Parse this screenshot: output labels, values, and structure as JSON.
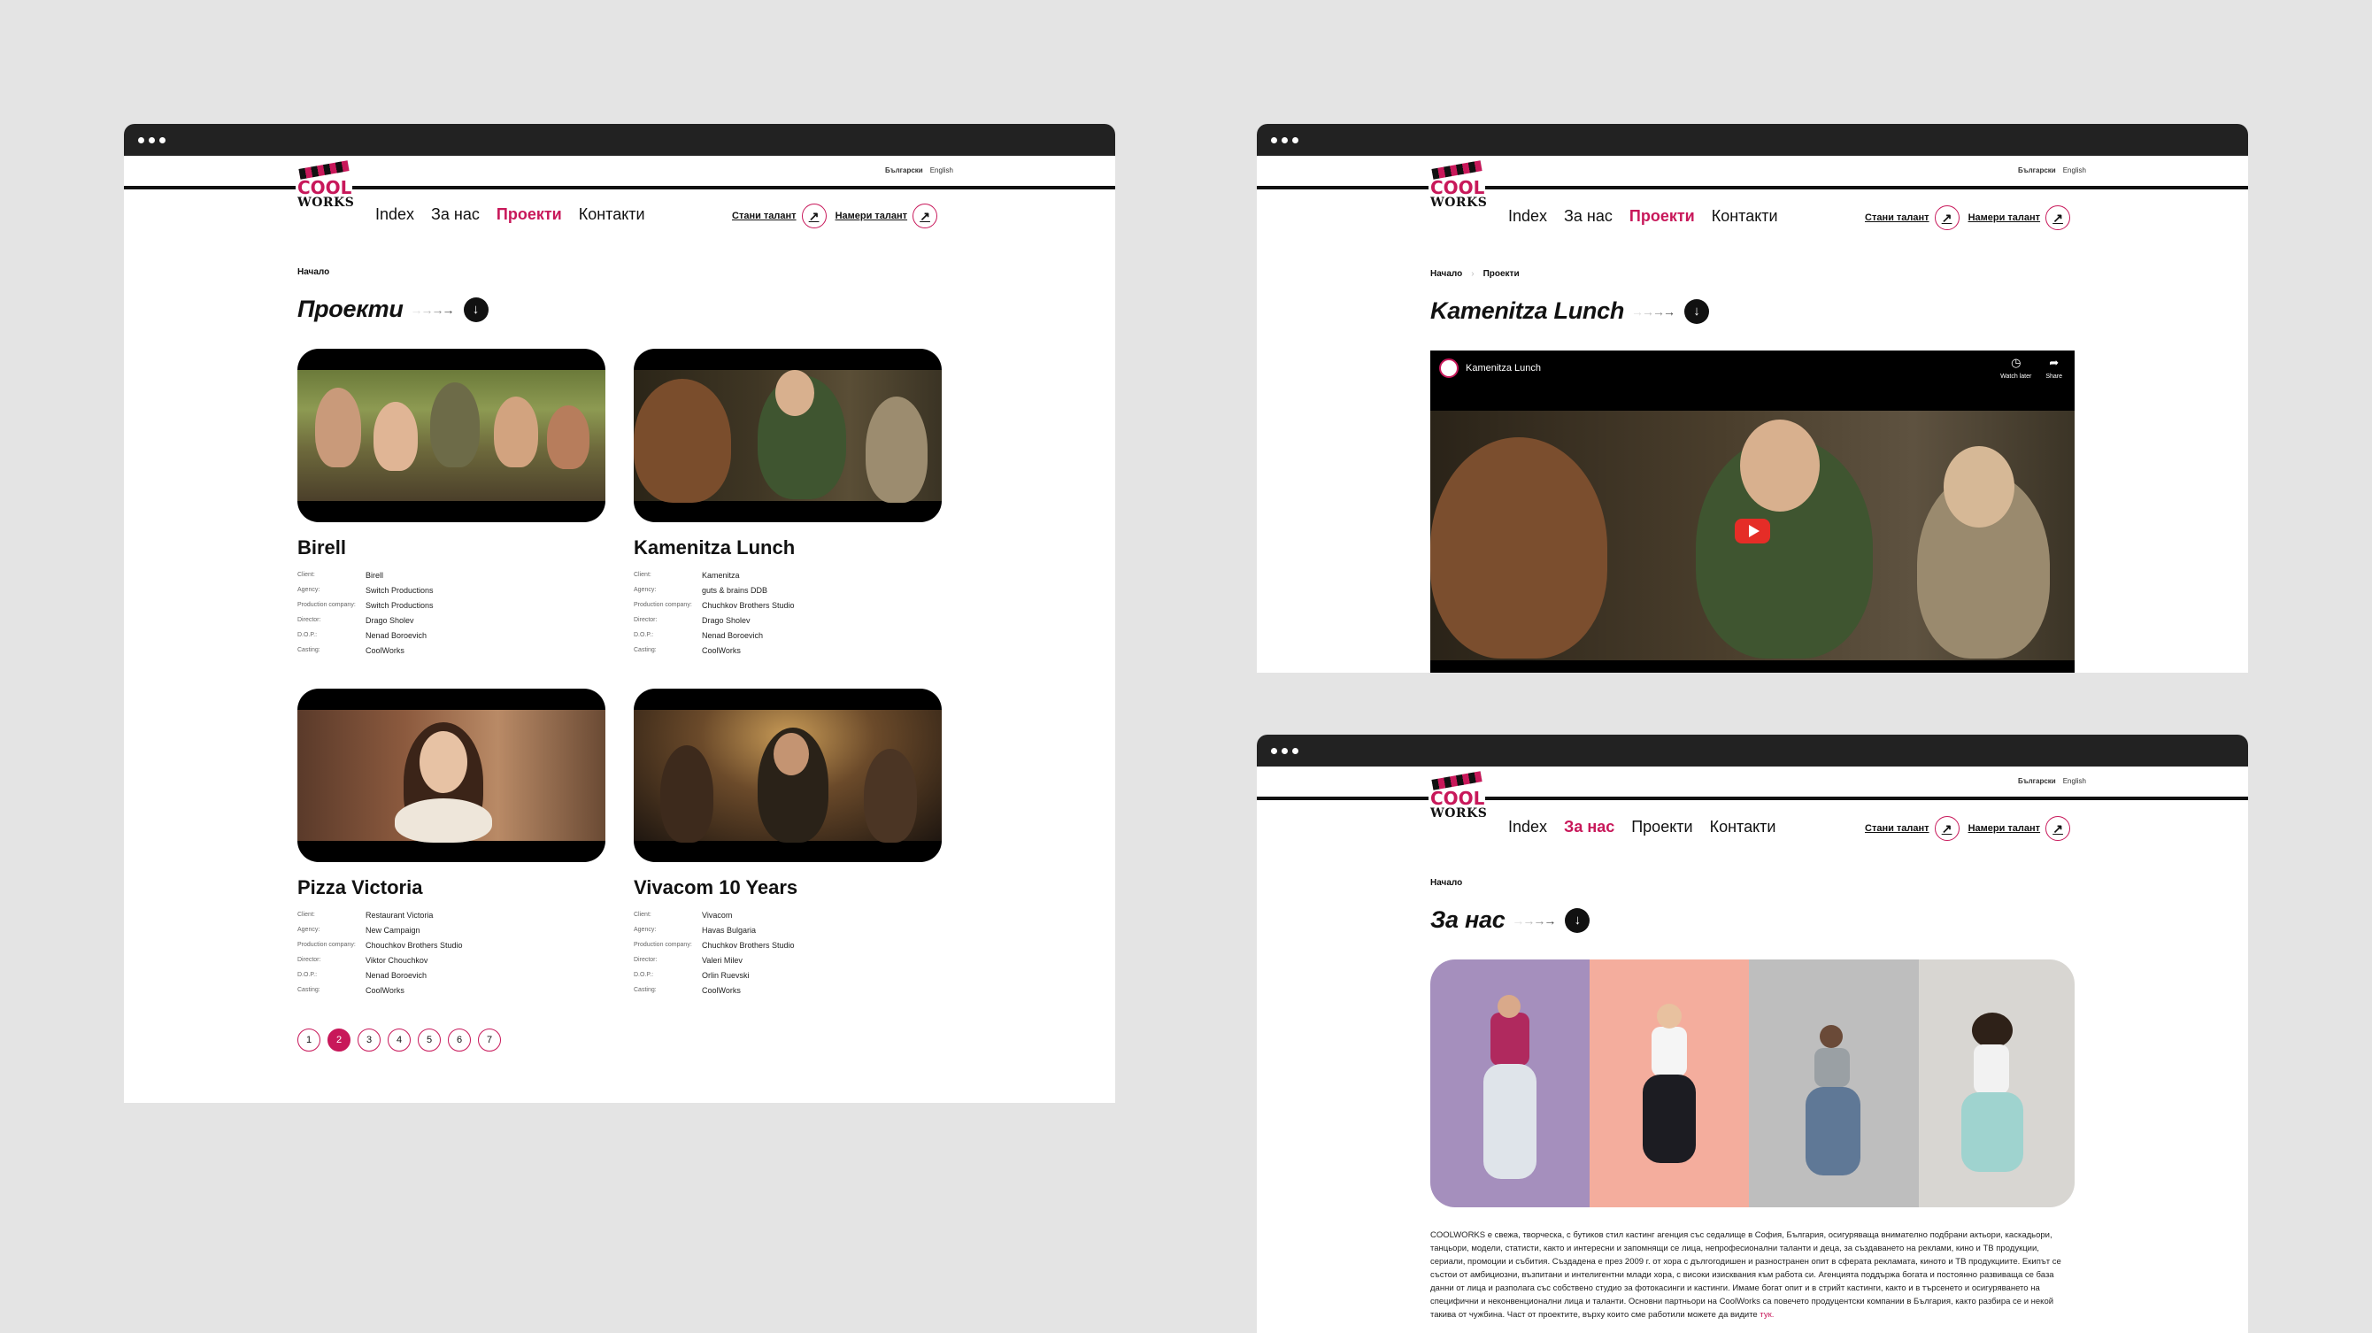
{
  "brand": {
    "logo_top": "COOL",
    "logo_bottom": "WORKS",
    "accent": "#c8185a",
    "dark": "#111111"
  },
  "lang": {
    "bg": "Български",
    "en": "English"
  },
  "nav": [
    "Index",
    "За нас",
    "Проекти",
    "Контакти"
  ],
  "cta": {
    "talent": "Стани талант",
    "find": "Намери талант",
    "icon": "arrow-up-right-icon"
  },
  "credit_labels": [
    "Client:",
    "Agency:",
    "Production company:",
    "Director:",
    "D.O.P.:",
    "Casting:"
  ],
  "projects_page": {
    "breadcrumb": "Начало",
    "title": "Проекти",
    "cards": [
      {
        "name": "Birell",
        "credits": [
          "Birell",
          "Switch Productions",
          "Switch Productions",
          "Drago Sholev",
          "Nenad Boroevich",
          "CoolWorks"
        ]
      },
      {
        "name": "Kamenitza Lunch",
        "credits": [
          "Kamenitza",
          "guts & brains DDB",
          "Chuchkov Brothers Studio",
          "Drago Sholev",
          "Nenad Boroevich",
          "CoolWorks"
        ]
      },
      {
        "name": "Pizza Victoria",
        "credits": [
          "Restaurant Victoria",
          "New Campaign",
          "Chouchkov Brothers Studio",
          "Viktor Chouchkov",
          "Nenad Boroevich",
          "CoolWorks"
        ]
      },
      {
        "name": "Vivacom 10 Years",
        "credits": [
          "Vivacom",
          "Havas Bulgaria",
          "Chuchkov Brothers Studio",
          "Valeri Milev",
          "Orlin Ruevski",
          "CoolWorks"
        ]
      }
    ],
    "pages": [
      "1",
      "2",
      "3",
      "4",
      "5",
      "6",
      "7"
    ],
    "current_page": "2"
  },
  "project_detail": {
    "breadcrumb": [
      "Начало",
      "Проекти"
    ],
    "title": "Kamenitza Lunch",
    "video": {
      "title": "Kamenitza Lunch",
      "watch_later": "Watch later",
      "share": "Share"
    }
  },
  "about_page": {
    "breadcrumb": "Начало",
    "title": "За нас",
    "panel_colors": [
      "#a58fbd",
      "#f4ad9d",
      "#bebebe",
      "#d8d6d2"
    ],
    "text": [
      "COOLWORKS е свежа, творческа, с бутиков стил кастинг агенция със  седалище в София, България, осигуряваща внимателно подбрани актьори,  каскадьори,",
      "танцьори, модели, статисти, както и  интересни и запомнящи  се лица, непрофесионални таланти и деца, за създаването на реклами,  кино и ТВ продукции,",
      "сериали, промоции и събития. Създадена е през 2009 г. от хора с дългогодишен и разностранен опит в сферата рекламата,  киното и ТВ продукциите. Екипът се",
      "състои от амбициозни, възпитани и  интелигентни млади хора, с високи изисквания към работа си. Агенцията  поддържа богата и постоянно развиваща се база",
      "данни от лица и разполага  със собствено студио за фотокасинги и кастинги. Имаме богат опит и в  стрийт кастинги, както и в търсенето и осигуряването на",
      "специфични и  неконвенционални лица и таланти. Основни партньори на CoolWorks са  повечето продуцентски компании в България, както разбира се и некой",
      "такива от чужбина. Част от проектите, върху които сме работили можете да  видите "
    ],
    "text_link": "тук."
  }
}
